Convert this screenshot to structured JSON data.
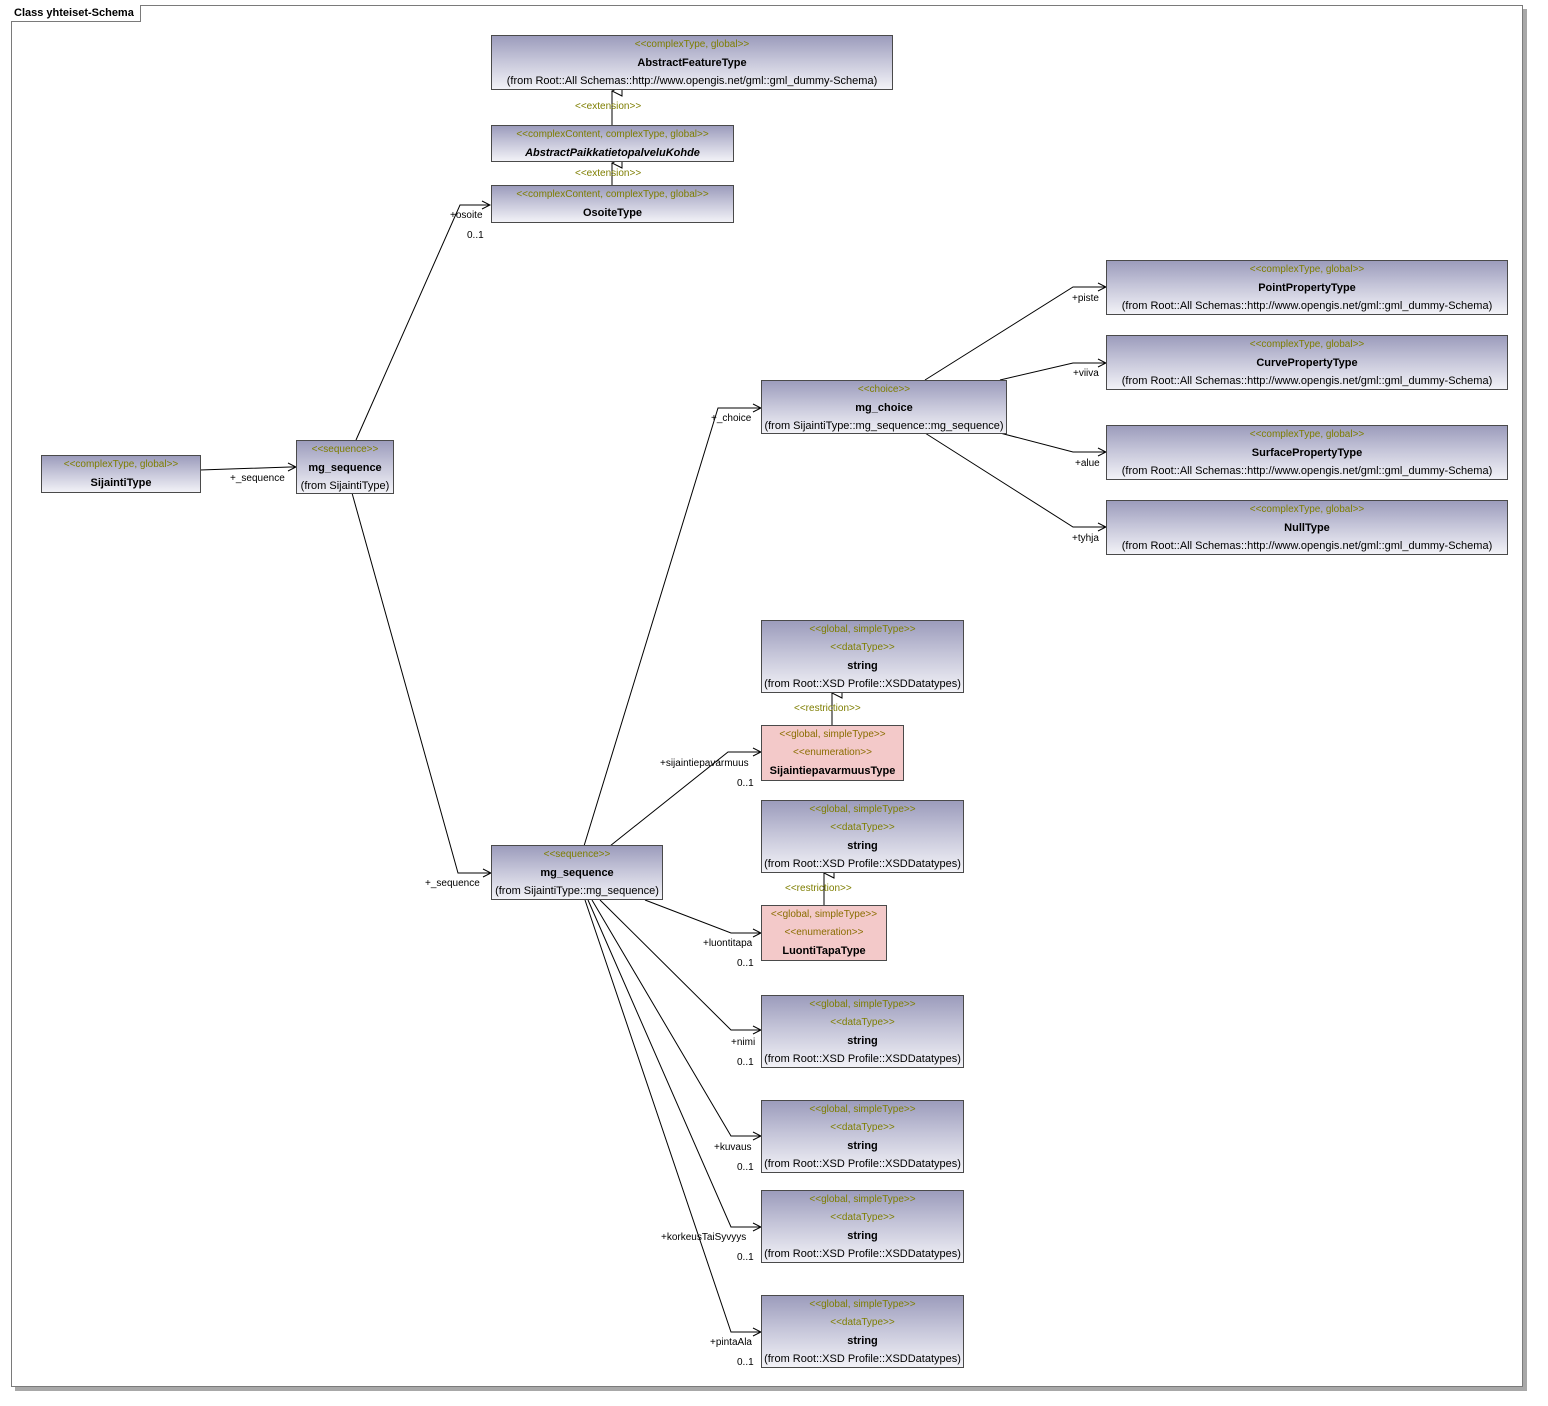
{
  "frame_title": "Class yhteiset-Schema",
  "classes": {
    "abstract_feature": {
      "stereotypes": [
        "<<complexType, global>>"
      ],
      "name": "AbstractFeatureType",
      "from": "(from Root::All Schemas::http://www.opengis.net/gml::gml_dummy-Schema)"
    },
    "abstract_paikka": {
      "stereotypes": [
        "<<complexContent, complexType, global>>"
      ],
      "name": "AbstractPaikkatietopalveluKohde"
    },
    "osoite": {
      "stereotypes": [
        "<<complexContent, complexType, global>>"
      ],
      "name": "OsoiteType"
    },
    "sijainti": {
      "stereotypes": [
        "<<complexType, global>>"
      ],
      "name": "SijaintiType"
    },
    "mg_seq1": {
      "stereotypes": [
        "<<sequence>>"
      ],
      "name": "mg_sequence",
      "from": "(from SijaintiType)"
    },
    "mg_choice": {
      "stereotypes": [
        "<<choice>>"
      ],
      "name": "mg_choice",
      "from": "(from SijaintiType::mg_sequence::mg_sequence)"
    },
    "point": {
      "stereotypes": [
        "<<complexType, global>>"
      ],
      "name": "PointPropertyType",
      "from": "(from Root::All Schemas::http://www.opengis.net/gml::gml_dummy-Schema)"
    },
    "curve": {
      "stereotypes": [
        "<<complexType, global>>"
      ],
      "name": "CurvePropertyType",
      "from": "(from Root::All Schemas::http://www.opengis.net/gml::gml_dummy-Schema)"
    },
    "surface": {
      "stereotypes": [
        "<<complexType, global>>"
      ],
      "name": "SurfacePropertyType",
      "from": "(from Root::All Schemas::http://www.opengis.net/gml::gml_dummy-Schema)"
    },
    "null": {
      "stereotypes": [
        "<<complexType, global>>"
      ],
      "name": "NullType",
      "from": "(from Root::All Schemas::http://www.opengis.net/gml::gml_dummy-Schema)"
    },
    "str1": {
      "stereotypes": [
        "<<global, simpleType>>",
        "<<dataType>>"
      ],
      "name": "string",
      "from": "(from Root::XSD Profile::XSDDatatypes)"
    },
    "sijaintiepa": {
      "stereotypes": [
        "<<global, simpleType>>",
        "<<enumeration>>"
      ],
      "name": "SijaintiepavarmuusType"
    },
    "str2": {
      "stereotypes": [
        "<<global, simpleType>>",
        "<<dataType>>"
      ],
      "name": "string",
      "from": "(from Root::XSD Profile::XSDDatatypes)"
    },
    "luonti": {
      "stereotypes": [
        "<<global, simpleType>>",
        "<<enumeration>>"
      ],
      "name": "LuontiTapaType"
    },
    "mg_seq2": {
      "stereotypes": [
        "<<sequence>>"
      ],
      "name": "mg_sequence",
      "from": "(from SijaintiType::mg_sequence)"
    },
    "str3": {
      "stereotypes": [
        "<<global, simpleType>>",
        "<<dataType>>"
      ],
      "name": "string",
      "from": "(from Root::XSD Profile::XSDDatatypes)"
    },
    "str4": {
      "stereotypes": [
        "<<global, simpleType>>",
        "<<dataType>>"
      ],
      "name": "string",
      "from": "(from Root::XSD Profile::XSDDatatypes)"
    },
    "str5": {
      "stereotypes": [
        "<<global, simpleType>>",
        "<<dataType>>"
      ],
      "name": "string",
      "from": "(from Root::XSD Profile::XSDDatatypes)"
    },
    "str6": {
      "stereotypes": [
        "<<global, simpleType>>",
        "<<dataType>>"
      ],
      "name": "string",
      "from": "(from Root::XSD Profile::XSDDatatypes)"
    }
  },
  "relation_labels": {
    "extension": "<<extension>>",
    "restriction": "<<restriction>>",
    "osoite_role": "+osoite",
    "osoite_mult": "0..1",
    "seq1_role": "+_sequence",
    "seq2_role": "+_sequence",
    "choice_role": "+_choice",
    "piste": "+piste",
    "viiva": "+viiva",
    "alue": "+alue",
    "tyhja": "+tyhja",
    "sijaintiepa_role": "+sijaintiepavarmuus",
    "sijaintiepa_mult": "0..1",
    "luonti_role": "+luontitapa",
    "luonti_mult": "0..1",
    "nimi_role": "+nimi",
    "nimi_mult": "0..1",
    "kuvaus_role": "+kuvaus",
    "kuvaus_mult": "0..1",
    "korkeus_role": "+korkeusTaiSyvyys",
    "korkeus_mult": "0..1",
    "pinta_role": "+pintaAla",
    "pinta_mult": "0..1"
  }
}
